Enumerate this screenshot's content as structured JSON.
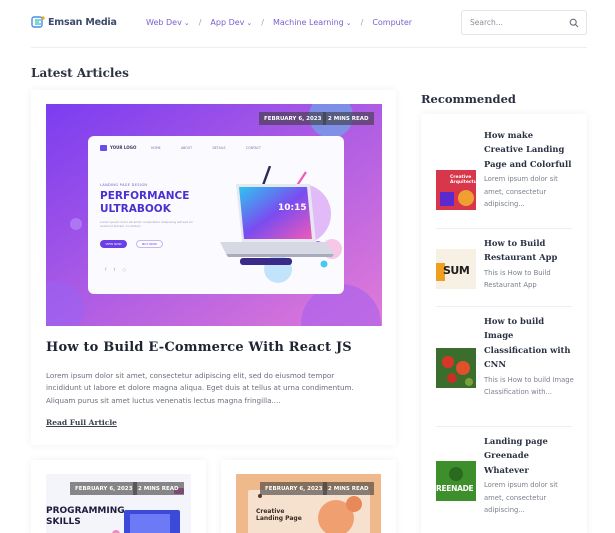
{
  "header": {
    "logo_text": "Emsan Media",
    "nav": [
      {
        "label": "Web Dev",
        "has_dropdown": true
      },
      {
        "label": "App Dev",
        "has_dropdown": true
      },
      {
        "label": "Machine Learning",
        "has_dropdown": true
      },
      {
        "label": "Computer",
        "has_dropdown": false
      }
    ],
    "search_placeholder": "Search..."
  },
  "latest": {
    "title": "Latest Articles",
    "featured": {
      "date": "FEBRUARY 6, 2023",
      "read_time": "2 MINS READ",
      "image_text": {
        "logo": "YOUR LOGO",
        "menu": [
          "HOME",
          "ABOUT",
          "DETAILS",
          "CONTACT"
        ],
        "kicker": "LANDING PAGE DESIGN",
        "headline_1": "PERFORMANCE",
        "headline_2": "ULTRABOOK",
        "blurb": "Lorem ipsum dolor sit amet consectetur adipiscing elit sed do eiusmod tempor incididunt.",
        "btn_primary": "VIEW NOW",
        "btn_secondary": "BUY NOW",
        "screen_time": "10:15"
      },
      "title": "How to Build E-Commerce With React JS",
      "excerpt": "Lorem ipsum dolor sit amet, consectetur adipiscing elit, sed do eiusmod tempor incididunt ut labore et dolore magna aliqua. Eget duis at tellus at urna condimentum. Aliquam purus sit amet luctus venenatis lectus magna fringilla....",
      "read_more": "Read Full Article"
    },
    "cards": [
      {
        "date": "FEBRUARY 6, 2023",
        "read_time": "2 MINS READ",
        "image_text_1": "PROGRAMMING",
        "image_text_2": "SKILLS"
      },
      {
        "date": "FEBRUARY 6, 2023",
        "read_time": "2 MINS READ",
        "image_text_1": "Creative",
        "image_text_2": "Landing Page"
      }
    ]
  },
  "recommended": {
    "title": "Recommended",
    "items": [
      {
        "title": "How make Creative Landing Page and Colorfull",
        "excerpt": "Lorem ipsum dolor sit amet, consectetur adipiscing...",
        "thumb_text": "Creative Arquitecture"
      },
      {
        "title": "How to Build Restaurant App",
        "excerpt": "This is How to Build Restaurant App",
        "thumb_text": "SUM"
      },
      {
        "title": "How to build Image Classification with CNN",
        "excerpt": "This is How to build Image Classification with...",
        "thumb_text": ""
      },
      {
        "title": "Landing page Greenade Whatever",
        "excerpt": "Lorem ipsum dolor sit amet, consectetur adipiscing...",
        "thumb_text": "REENADE"
      }
    ]
  },
  "colors": {
    "accent": "#7b5fd0",
    "heading": "#2a3142",
    "hero_gradient_start": "#7b3df0",
    "hero_gradient_end": "#e07bd8"
  }
}
